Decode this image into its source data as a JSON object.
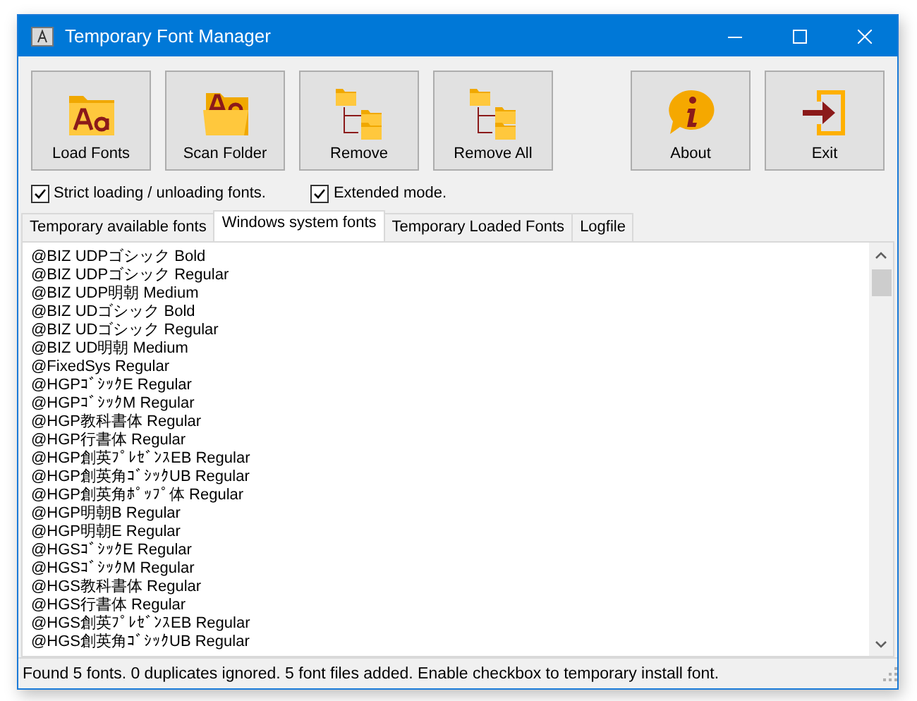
{
  "window": {
    "title": "Temporary Font Manager"
  },
  "toolbar": [
    {
      "label": "Load Fonts",
      "kind": "load"
    },
    {
      "label": "Scan Folder",
      "kind": "scan"
    },
    {
      "label": "Remove",
      "kind": "remove"
    },
    {
      "label": "Remove All",
      "kind": "removeall"
    },
    {
      "label": "About",
      "kind": "about"
    },
    {
      "label": "Exit",
      "kind": "exit"
    }
  ],
  "options": [
    {
      "label": "Strict loading / unloading fonts.",
      "checked": true
    },
    {
      "label": "Extended mode.",
      "checked": true
    }
  ],
  "tabs": [
    {
      "label": "Temporary available fonts",
      "selected": false
    },
    {
      "label": "Windows system fonts",
      "selected": true
    },
    {
      "label": "Temporary Loaded Fonts",
      "selected": false
    },
    {
      "label": "Logfile",
      "selected": false
    }
  ],
  "fonts": [
    "@BIZ UDPゴシック Bold",
    "@BIZ UDPゴシック Regular",
    "@BIZ UDP明朝 Medium",
    "@BIZ UDゴシック Bold",
    "@BIZ UDゴシック Regular",
    "@BIZ UD明朝 Medium",
    "@FixedSys Regular",
    "@HGPｺﾞｼｯｸE Regular",
    "@HGPｺﾞｼｯｸM Regular",
    "@HGP教科書体 Regular",
    "@HGP行書体 Regular",
    "@HGP創英ﾌﾟﾚｾﾞﾝｽEB Regular",
    "@HGP創英角ｺﾞｼｯｸUB Regular",
    "@HGP創英角ﾎﾟｯﾌﾟ体 Regular",
    "@HGP明朝B Regular",
    "@HGP明朝E Regular",
    "@HGSｺﾞｼｯｸE Regular",
    "@HGSｺﾞｼｯｸM Regular",
    "@HGS教科書体 Regular",
    "@HGS行書体 Regular",
    "@HGS創英ﾌﾟﾚｾﾞﾝｽEB Regular",
    "@HGS創英角ｺﾞｼｯｸUB Regular"
  ],
  "status_bar": "Found 5 fonts.  0 duplicates ignored.  5 font files added.  Enable checkbox to temporary install font."
}
